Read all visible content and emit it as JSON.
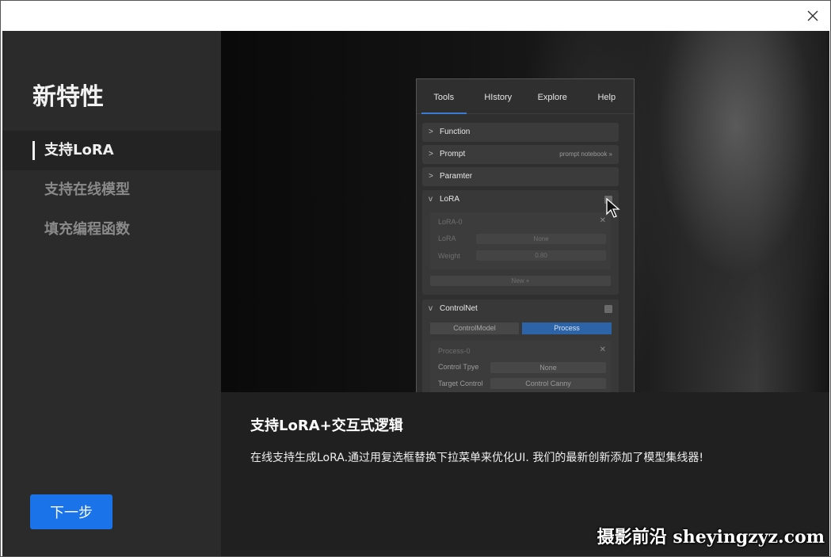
{
  "window": {
    "close_icon": "close-icon"
  },
  "sidebar": {
    "title": "新特性",
    "items": [
      {
        "label": "支持LoRA",
        "active": true
      },
      {
        "label": "支持在线模型",
        "active": false
      },
      {
        "label": "填充编程函数",
        "active": false
      }
    ],
    "next_button": "下一步"
  },
  "preview": {
    "tabs": [
      "Tools",
      "HIstory",
      "Explore",
      "Help"
    ],
    "active_tab": "Tools",
    "sections": {
      "function": "Function",
      "prompt": "Prompt",
      "prompt_notebook": "prompt notebook »",
      "paramter": "Paramter",
      "lora": "LoRA",
      "controlnet": "ControlNet"
    },
    "lora_card": {
      "title": "LoRA-0",
      "lora_label": "LoRA",
      "lora_value": "None",
      "weight_label": "Weight",
      "weight_value": "0.80",
      "new_button": "New +"
    },
    "controlnet_card": {
      "control_model": "ControlModel",
      "process": "Process",
      "process_title": "Process-0",
      "control_type_label": "Control Tpye",
      "control_type_value": "None",
      "target_control_label": "Target Control",
      "target_control_value": "Control Canny"
    }
  },
  "caption": {
    "title": "支持LoRA+交互式逻辑",
    "text": "在线支持生成LoRA.通过用复选框替换下拉菜单来优化UI. 我们的最新创新添加了模型集线器!"
  },
  "watermark": "摄影前沿 sheyingzyz.com",
  "colors": {
    "accent": "#1a73e8",
    "sidebar_bg": "#2b2b2b",
    "caption_bg": "#202020"
  }
}
